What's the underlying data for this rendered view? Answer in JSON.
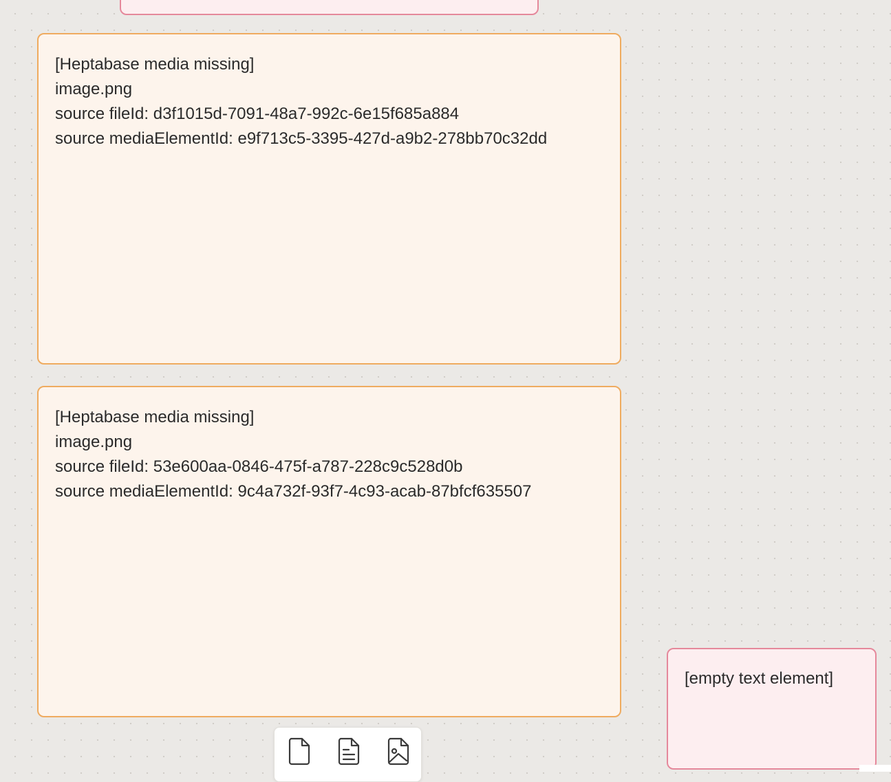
{
  "canvas": {
    "background_color": "#ebe9e6",
    "dot_color": "#cfcbc5"
  },
  "cards": {
    "top_partial": {
      "color": "pink"
    },
    "media_1": {
      "color": "orange",
      "title": "[Heptabase media missing]",
      "filename": "image.png",
      "file_id_line": "source fileId: d3f1015d-7091-48a7-992c-6e15f685a884",
      "media_element_line": "source mediaElementId: e9f713c5-3395-427d-a9b2-278bb70c32dd"
    },
    "media_2": {
      "color": "orange",
      "title": "[Heptabase media missing]",
      "filename": "image.png",
      "file_id_line": "source fileId: 53e600aa-0846-475f-a787-228c9c528d0b",
      "media_element_line": "source mediaElementId: 9c4a732f-93f7-4c93-acab-87bfcf635507"
    },
    "empty_text": {
      "color": "pink",
      "text": "[empty text element]"
    }
  },
  "colors": {
    "orange_fill": "#fdf4ec",
    "orange_border": "#efab5f",
    "pink_fill": "#fdeef0",
    "pink_border": "#e5889b"
  },
  "toolbar": {
    "buttons": [
      {
        "icon": "blank-page-icon"
      },
      {
        "icon": "text-document-icon"
      },
      {
        "icon": "image-file-icon"
      }
    ]
  }
}
